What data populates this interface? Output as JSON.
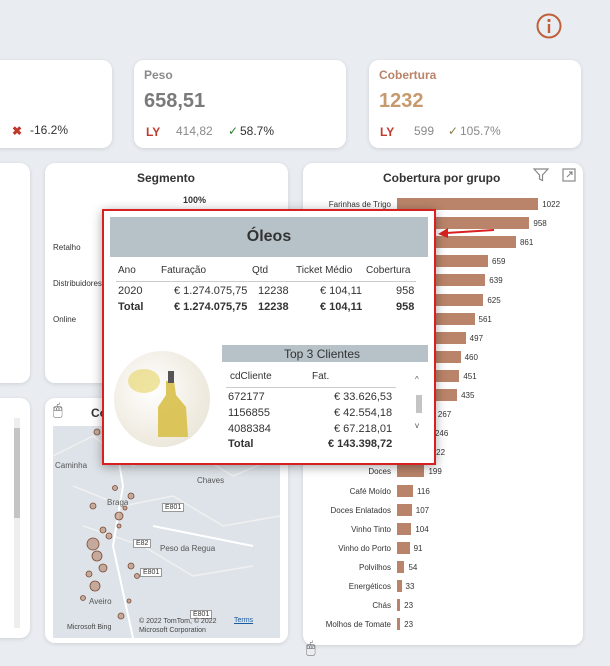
{
  "header": {
    "info_icon": "info-icon"
  },
  "kpi_left": {
    "delta": "-16.2%",
    "delta_icon": "cross-icon"
  },
  "kpi_peso": {
    "title": "Peso",
    "value": "658,51",
    "ly_label": "LY",
    "ly_value": "414,82",
    "delta": "58.7%",
    "delta_icon": "check-icon"
  },
  "kpi_cobertura": {
    "title": "Cobertura",
    "value": "1232",
    "ly_label": "LY",
    "ly_value": "599",
    "delta": "105.7%",
    "delta_icon": "check-icon"
  },
  "segmento": {
    "title": "Segmento",
    "pct_label": "100%",
    "rows": [
      "Retalho",
      "Distribuidores",
      "Online"
    ]
  },
  "map_panel": {
    "title_partial": "Co",
    "cities": [
      "Caminha",
      "Braga",
      "Chaves",
      "Peso da Regua",
      "Aveiro"
    ],
    "road_labels": [
      "E82",
      "E801",
      "E801",
      "E801"
    ],
    "attribution": "© 2022 TomTom, © 2022 Microsoft Corporation",
    "terms_link": "Terms",
    "bing_logo": "Microsoft Bing"
  },
  "cobertura_grupo": {
    "title": "Cobertura por grupo",
    "filter_icon": "filter-icon",
    "focus_icon": "focus-mode-icon"
  },
  "chart_data": {
    "type": "bar",
    "title": "Cobertura por grupo",
    "categories": [
      "Farinhas de Trigo",
      "Óleos",
      "",
      "",
      "",
      "",
      "",
      "",
      "",
      "",
      "",
      "",
      "",
      "",
      "Doces",
      "Café Moído",
      "Doces Enlatados",
      "Vinho Tinto",
      "Vinho do Porto",
      "Polvilhos",
      "Energéticos",
      "Chás",
      "Molhos de Tomate"
    ],
    "values": [
      1022,
      958,
      861,
      659,
      639,
      625,
      561,
      497,
      460,
      451,
      435,
      267,
      246,
      222,
      199,
      116,
      107,
      104,
      91,
      54,
      33,
      23,
      23
    ],
    "value_labels": [
      "1022",
      "958",
      "861",
      "659",
      "639",
      "625",
      "561",
      "497",
      "460",
      "451",
      "435",
      "267",
      "246",
      "222",
      "199",
      "116",
      "107",
      "104",
      "91",
      "54",
      "33",
      "23",
      "23"
    ],
    "orientation": "horizontal",
    "xlim": [
      0,
      1100
    ],
    "bar_color": "#b98469",
    "legend": "none",
    "grid": false
  },
  "tooltip": {
    "title": "Óleos",
    "columns": [
      "Ano",
      "Faturação",
      "Qtd",
      "Ticket Médio",
      "Cobertura"
    ],
    "rows": [
      {
        "ano": "2020",
        "faturacao": "€ 1.274.075,75",
        "qtd": "12238",
        "ticket": "€ 104,11",
        "cobertura": "958"
      },
      {
        "ano": "Total",
        "faturacao": "€ 1.274.075,75",
        "qtd": "12238",
        "ticket": "€ 104,11",
        "cobertura": "958"
      }
    ],
    "top3": {
      "title": "Top 3 Clientes",
      "col_cliente": "cdCliente",
      "col_fat": "Fat.",
      "rows": [
        {
          "cliente": "672177",
          "fat": "€ 33.626,53"
        },
        {
          "cliente": "1156855",
          "fat": "€ 42.554,18"
        },
        {
          "cliente": "4088384",
          "fat": "€ 67.218,01"
        }
      ],
      "total_label": "Total",
      "total_value": "€ 143.398,72"
    },
    "image_icon": "olive-oil-bottle-image"
  },
  "colors": {
    "accent_brown": "#b98469",
    "ly_red": "#c0392b",
    "check_green": "#2e7d32",
    "tooltip_border": "#d82020",
    "tooltip_header": "#b7c2c8"
  }
}
